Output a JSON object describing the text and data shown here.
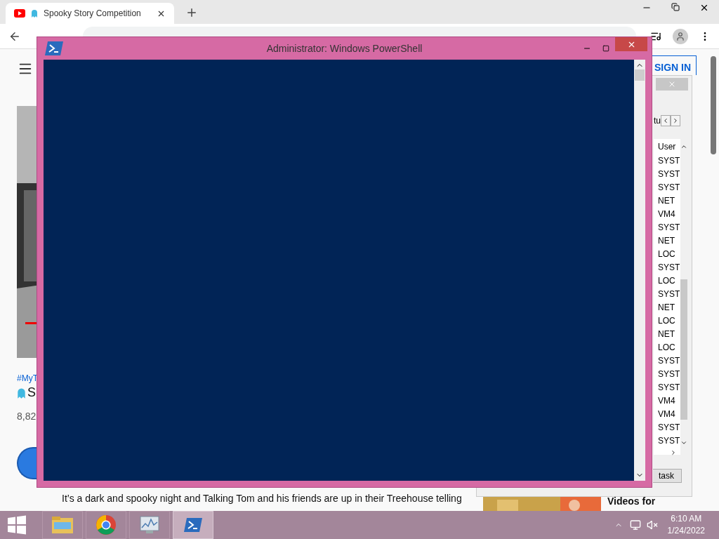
{
  "browser": {
    "tab_title": "Spooky Story Competition",
    "sign_in": "SIGN IN",
    "hashtag": "#MyT",
    "video_title": "S",
    "views": "8,82",
    "description": "It’s a dark and spooky night and Talking Tom and his friends are up in their Treehouse telling",
    "sidebar_video_title": "Videos for"
  },
  "task_manager": {
    "column_1": "tu",
    "column_2": "User",
    "rows": [
      "SYST",
      "SYST",
      "SYST",
      "NET",
      "VM4",
      "SYST",
      "NET",
      "LOC",
      "SYST",
      "LOC",
      "SYST",
      "NET",
      "LOC",
      "NET",
      "LOC",
      "SYST",
      "SYST",
      "SYST",
      "VM4",
      "VM4",
      "SYST",
      "SYST"
    ],
    "button": "task"
  },
  "powershell": {
    "title": "Administrator: Windows PowerShell"
  },
  "taskbar": {
    "apps": [
      {
        "kind": "explorer",
        "selected": false
      },
      {
        "kind": "chrome",
        "selected": false
      },
      {
        "kind": "taskmgr",
        "selected": false
      },
      {
        "kind": "powershell",
        "selected": true
      }
    ],
    "time": "6:10 AM",
    "date": "1/24/2022"
  }
}
